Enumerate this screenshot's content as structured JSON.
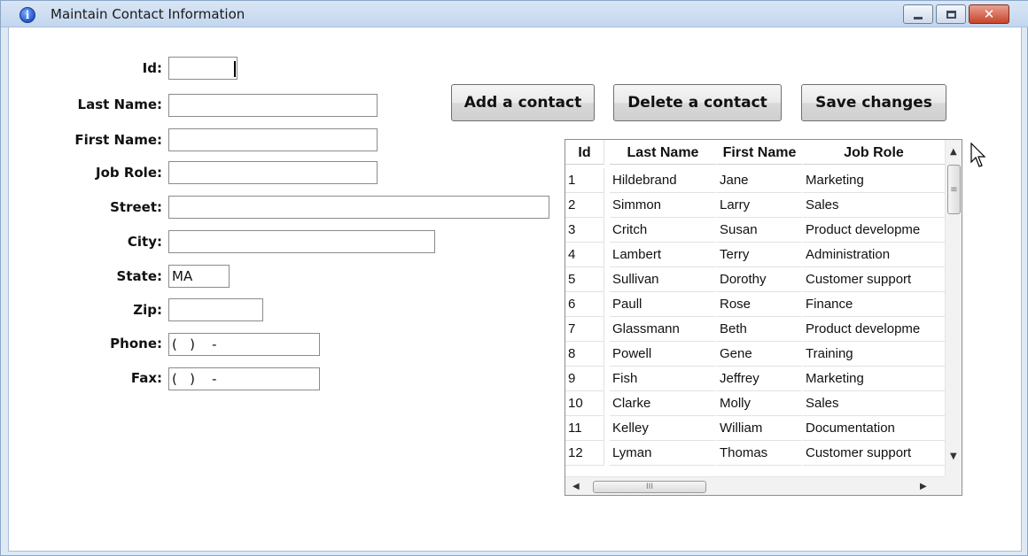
{
  "window": {
    "title": "Maintain Contact Information",
    "close_glyph": "✕"
  },
  "form": {
    "fields": [
      {
        "label": "Id:",
        "value": ""
      },
      {
        "label": "Last Name:",
        "value": ""
      },
      {
        "label": "First Name:",
        "value": ""
      },
      {
        "label": "Job Role:",
        "value": ""
      },
      {
        "label": "Street:",
        "value": ""
      },
      {
        "label": "City:",
        "value": ""
      },
      {
        "label": "State:",
        "value": "MA"
      },
      {
        "label": "Zip:",
        "value": ""
      },
      {
        "label": "Phone:",
        "value": "(   )    -"
      },
      {
        "label": "Fax:",
        "value": "(   )    -"
      }
    ]
  },
  "toolbar": {
    "add_label": "Add a contact",
    "delete_label": "Delete a contact",
    "save_label": "Save changes"
  },
  "table": {
    "columns": [
      "Id",
      "Last Name",
      "First Name",
      "Job Role"
    ],
    "rows": [
      [
        "1",
        "Hildebrand",
        "Jane",
        "Marketing"
      ],
      [
        "2",
        "Simmon",
        "Larry",
        "Sales"
      ],
      [
        "3",
        "Critch",
        "Susan",
        "Product developme"
      ],
      [
        "4",
        "Lambert",
        "Terry",
        "Administration"
      ],
      [
        "5",
        "Sullivan",
        "Dorothy",
        "Customer support"
      ],
      [
        "6",
        "Paull",
        "Rose",
        "Finance"
      ],
      [
        "7",
        "Glassmann",
        "Beth",
        "Product developme"
      ],
      [
        "8",
        "Powell",
        "Gene",
        "Training"
      ],
      [
        "9",
        "Fish",
        "Jeffrey",
        "Marketing"
      ],
      [
        "10",
        "Clarke",
        "Molly",
        "Sales"
      ],
      [
        "11",
        "Kelley",
        "William",
        "Documentation"
      ],
      [
        "12",
        "Lyman",
        "Thomas",
        "Customer support"
      ]
    ],
    "scroll_up_glyph": "▲",
    "scroll_down_glyph": "▼",
    "scroll_left_glyph": "◀",
    "scroll_right_glyph": "▶",
    "thumb_grip": "≡",
    "hthumb_grip": "III"
  },
  "icons": {
    "title_icon": "info-icon",
    "title_icon_glyph": "i"
  }
}
